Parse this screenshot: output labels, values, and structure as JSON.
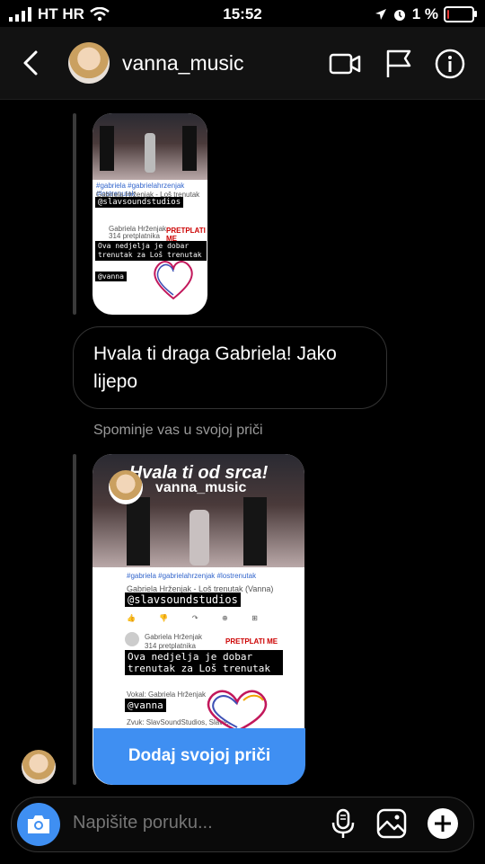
{
  "status_bar": {
    "carrier": "HT HR",
    "time": "15:52",
    "battery_percent": "1 %",
    "battery_level": 0.05,
    "icons": [
      "signal-icon",
      "wifi-icon",
      "location-icon",
      "alarm-icon",
      "battery-icon"
    ]
  },
  "header": {
    "username": "vanna_music",
    "icons": [
      "back-icon",
      "video-call-icon",
      "flag-icon",
      "info-icon"
    ]
  },
  "messages": {
    "story_shared_1": {
      "hashtags": "#gabriela #gabrielahrzenjak #lostrenutak",
      "video_title": "Gabriela Hrženjak - Loš trenutak (Vanna)",
      "tag": "@slavsoundstudios",
      "channel": "Gabriela Hrženjak",
      "subscribers": "314 pretplatnika",
      "subscribe": "PRETPLATI ME",
      "caption": "Ova nedjelja je dobar trenutak za Loš trenutak",
      "mention_tag": "@vanna"
    },
    "reply_text": "Hvala ti draga Gabriela! Jako lijepo",
    "mention_notice": "Spominje vas u svojoj priči",
    "story_shared_2": {
      "overlay_title": "Hvala ti od srca!",
      "username": "vanna_music",
      "hashtags": "#gabriela #gabrielahrzenjak #lostrenutak",
      "video_title": "Gabriela Hrženjak - Loš trenutak (Vanna)",
      "tag": "@slavsoundstudios",
      "channel": "Gabriela Hrženjak",
      "subscribers": "314 pretplatnika",
      "subscribe": "PRETPLATI ME",
      "caption": "Ova nedjelja je dobar trenutak za Loš trenutak",
      "mention_tag": "@vanna",
      "vocals_line": "Vokal: Gabriela Hrženjak",
      "sound_line": "Zvuk: SlavSoundStudios, Slave...",
      "add_button": "Dodaj svojoj priči"
    }
  },
  "composer": {
    "placeholder": "Napišite poruku...",
    "icons": [
      "camera-icon",
      "microphone-icon",
      "gallery-icon",
      "plus-icon"
    ]
  },
  "colors": {
    "accent": "#3f8ff2",
    "background": "#000000",
    "header_bg": "#121212",
    "muted_text": "#9a9a9a"
  }
}
